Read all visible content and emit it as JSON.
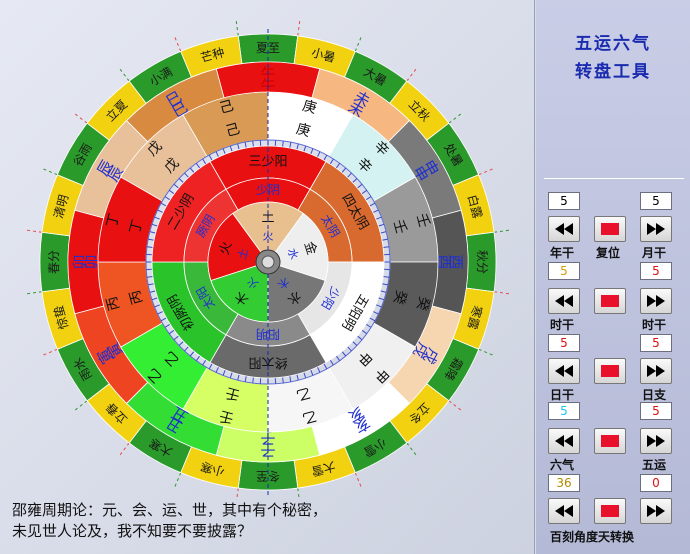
{
  "app": {
    "title_line1": "五运六气",
    "title_line2": "转盘工具"
  },
  "caption": {
    "line1": "邵雍周期论：元、会、运、世，其中有个秘密，",
    "line2": "未见世人论及，我不知要不要披露？"
  },
  "colors": {
    "title": "#1a2bb0",
    "accent_red": "#e8102a",
    "ring_green": "#2a9a2a",
    "ring_yellow": "#f2d210"
  },
  "controls": {
    "nian_gan": {
      "label": "年干",
      "value": "5",
      "color": "#111111"
    },
    "yue_gan": {
      "label": "月干",
      "value": "5",
      "color": "#111111"
    },
    "reset": {
      "label": "复位"
    },
    "shi_gan": {
      "label": "时干",
      "value": "5",
      "color": "#d4a000"
    },
    "shi_zhi": {
      "label": "时干",
      "value": "5",
      "color": "#dd1111"
    },
    "ri_gan": {
      "label": "日干",
      "value": "5",
      "color": "#dd1111"
    },
    "ri_zhi_val": {
      "value": "5",
      "color": "#dd1111"
    },
    "ri_gan2": {
      "label": "日干",
      "value": "5",
      "color": "#22c4ee"
    },
    "ri_zhi": {
      "label": "日支",
      "value": "5",
      "color": "#dd1111"
    },
    "liu_qi": {
      "label": "六气",
      "value": "36",
      "color": "#b08a00"
    },
    "wu_yun": {
      "label": "五运",
      "value": "0",
      "color": "#dd1111"
    },
    "bottom": {
      "label": "百刻角度天转换"
    }
  },
  "wheel": {
    "solar_terms": [
      "夏至",
      "小暑",
      "大暑",
      "立秋",
      "处暑",
      "白露",
      "秋分",
      "寒露",
      "霜降",
      "立冬",
      "小雪",
      "大雪",
      "冬至",
      "小寒",
      "大寒",
      "立春",
      "雨水",
      "惊蛰",
      "春分",
      "清明",
      "谷雨",
      "立夏",
      "小满",
      "芒种"
    ],
    "term_colors": [
      "#2a9a2a",
      "#f2d210"
    ],
    "branch_ring": [
      {
        "text": "午",
        "color": "#d00000",
        "fill": "#e81010"
      },
      {
        "text": "未",
        "color": "#1f2fd0",
        "fill": "#f6b880"
      },
      {
        "text": "申",
        "color": "#1f2fd0",
        "fill": "#7a7a7a"
      },
      {
        "text": "酉",
        "color": "#1f2fd0",
        "fill": "#555555"
      },
      {
        "text": "戌",
        "color": "#1f2fd0",
        "fill": "#f6d6b0"
      },
      {
        "text": "亥",
        "color": "#1f2fd0",
        "fill": "#ffffff"
      },
      {
        "text": "子",
        "color": "#1f2fd0",
        "fill": "#ccff66"
      },
      {
        "text": "丑",
        "color": "#1f2fd0",
        "fill": "#33dd33"
      },
      {
        "text": "寅",
        "color": "#1f2fd0",
        "fill": "#ee4422"
      },
      {
        "text": "卯",
        "color": "#1f2fd0",
        "fill": "#e81010"
      },
      {
        "text": "辰",
        "color": "#1f2fd0",
        "fill": "#e8c09a"
      },
      {
        "text": "巳",
        "color": "#1f2fd0",
        "fill": "#d88a40"
      }
    ],
    "stem_ring": [
      {
        "text": "庚",
        "fill": "#ffffff"
      },
      {
        "text": "辛",
        "fill": "#d4f2f2"
      },
      {
        "text": "壬",
        "fill": "#9a9a9a"
      },
      {
        "text": "癸",
        "fill": "#5a5a5a"
      },
      {
        "text": "甲",
        "fill": "#f0f0f0"
      },
      {
        "text": "乙",
        "fill": "#f6f6f6"
      },
      {
        "text": "壬",
        "fill": "#d6ff66"
      },
      {
        "text": "乙",
        "fill": "#33ee33"
      },
      {
        "text": "丙",
        "fill": "#ee5522"
      },
      {
        "text": "丁",
        "fill": "#e81010"
      },
      {
        "text": "戊",
        "fill": "#e8c09a"
      },
      {
        "text": "己",
        "fill": "#d89a55"
      }
    ],
    "qi_ring": [
      {
        "text": "三少阳",
        "fill": "#e81010"
      },
      {
        "text": "四太阴",
        "fill": "#d86a30"
      },
      {
        "text": "五阳明",
        "fill": "#ffffff"
      },
      {
        "text": "终太阳",
        "fill": "#6a6a6a"
      },
      {
        "text": "初厥阴",
        "fill": "#2ac42a"
      },
      {
        "text": "二少阴",
        "fill": "#ee2222"
      }
    ],
    "inner_ring": [
      {
        "text": "少阴",
        "fill": "#e81010"
      },
      {
        "text": "太阴",
        "fill": "#d86a30"
      },
      {
        "text": "少阳",
        "fill": "#e6e6e6"
      },
      {
        "text": "阳明",
        "fill": "#8a8a8a"
      },
      {
        "text": "太阳",
        "fill": "#3ab83a"
      },
      {
        "text": "厥阴",
        "fill": "#ee3333"
      }
    ],
    "core": [
      {
        "text": "土",
        "fill": "#e8c090"
      },
      {
        "text": "金",
        "fill": "#eeeeee"
      },
      {
        "text": "水",
        "fill": "#777777"
      },
      {
        "text": "木",
        "fill": "#33cc33"
      },
      {
        "text": "火",
        "fill": "#e81010"
      }
    ],
    "core_inner": [
      "火",
      "水",
      "木",
      "火",
      "土"
    ]
  }
}
